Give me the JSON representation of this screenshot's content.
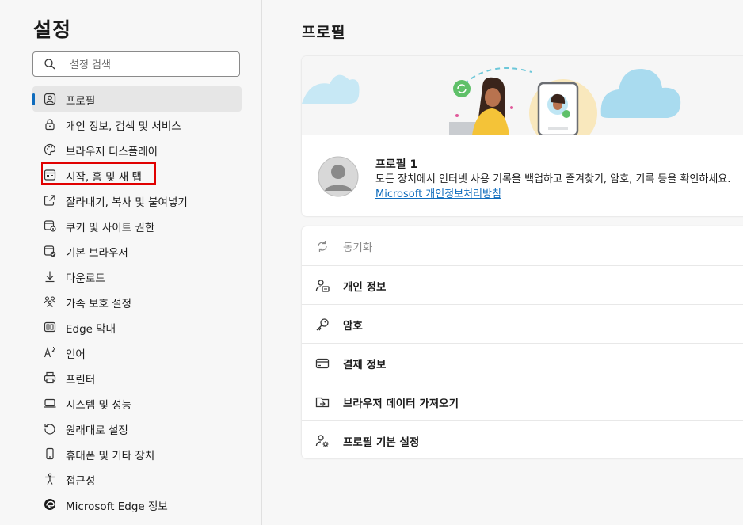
{
  "sidebar": {
    "title": "설정",
    "search_placeholder": "설정 검색",
    "items": [
      {
        "label": "프로필",
        "icon": "profile-icon"
      },
      {
        "label": "개인 정보, 검색 및 서비스",
        "icon": "lock-icon"
      },
      {
        "label": "브라우저 디스플레이",
        "icon": "palette-icon"
      },
      {
        "label": "시작, 홈 및 새 탭",
        "icon": "home-tab-icon"
      },
      {
        "label": "잘라내기, 복사 및 붙여넣기",
        "icon": "share-icon"
      },
      {
        "label": "쿠키 및 사이트 권한",
        "icon": "cookie-icon"
      },
      {
        "label": "기본 브라우저",
        "icon": "default-browser-icon"
      },
      {
        "label": "다운로드",
        "icon": "download-icon"
      },
      {
        "label": "가족 보호 설정",
        "icon": "family-icon"
      },
      {
        "label": "Edge 막대",
        "icon": "edge-bar-icon"
      },
      {
        "label": "언어",
        "icon": "language-icon"
      },
      {
        "label": "프린터",
        "icon": "printer-icon"
      },
      {
        "label": "시스템 및 성능",
        "icon": "system-icon"
      },
      {
        "label": "원래대로 설정",
        "icon": "reset-icon"
      },
      {
        "label": "휴대폰 및 기타 장치",
        "icon": "phone-icon"
      },
      {
        "label": "접근성",
        "icon": "accessibility-icon"
      },
      {
        "label": "Microsoft Edge 정보",
        "icon": "edge-logo-icon"
      }
    ],
    "active_index": 0,
    "highlighted_index": 3
  },
  "main": {
    "title": "프로필",
    "profile": {
      "name": "프로필 1",
      "desc_text": "모든 장치에서 인터넷 사용 기록을 백업하고 즐겨찾기, 암호, 기록 등을 확인하세요. ",
      "link_text": "Microsoft 개인정보처리방침"
    },
    "list": [
      {
        "label": "동기화",
        "icon": "sync-icon",
        "disabled": true
      },
      {
        "label": "개인 정보",
        "icon": "personal-info-icon"
      },
      {
        "label": "암호",
        "icon": "key-icon"
      },
      {
        "label": "결제 정보",
        "icon": "card-icon"
      },
      {
        "label": "브라우저 데이터 가져오기",
        "icon": "import-icon"
      },
      {
        "label": "프로필 기본 설정",
        "icon": "profile-settings-icon"
      }
    ]
  },
  "colors": {
    "accent": "#0f6cbd",
    "highlight": "#e00000",
    "cloud": "#b9e2f3"
  }
}
